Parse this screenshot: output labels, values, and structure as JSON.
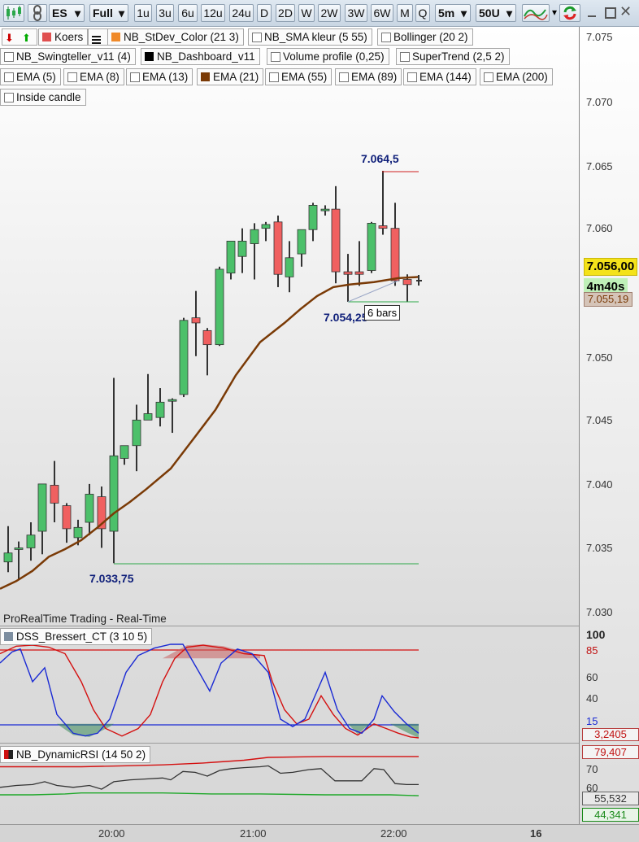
{
  "toolbar": {
    "symbol": "ES",
    "mode": "Full",
    "timeframes": [
      "1u",
      "3u",
      "6u",
      "12u",
      "24u",
      "D",
      "2D",
      "W",
      "2W",
      "3W",
      "6W",
      "M",
      "Q"
    ],
    "interval": "5m",
    "units": "50U"
  },
  "indicators": {
    "row1": [
      "Koers",
      "NB_StDev_Color (21 3)",
      "NB_SMA kleur (5 55)",
      "Bollinger (20 2)"
    ],
    "row2": [
      "NB_Swingteller_v11 (4)",
      "NB_Dashboard_v11",
      "Volume profile (0,25)",
      "SuperTrend (2,5 2)"
    ],
    "row3": [
      "EMA (5)",
      "EMA (8)",
      "EMA (13)",
      "EMA (21)",
      "EMA (55)",
      "EMA (89)",
      "EMA (144)",
      "EMA (200)"
    ],
    "row4": [
      "Inside candle"
    ],
    "dss": "DSS_Bressert_CT (3 10 5)",
    "rsi": "NB_DynamicRSI (14 50 2)",
    "colors": {
      "ema21": "#7a3a06",
      "dss_swatch": "#7d8ea0",
      "rsi_red": "#d01010"
    }
  },
  "chart": {
    "high_label": "7.064,5",
    "low_label": "7.033,75",
    "swing_low_label": "7.054,25",
    "bars_label": "6 bars",
    "footer": "ProRealTime Trading - Real-Time"
  },
  "price_axis": {
    "ticks": [
      "7.075",
      "7.070",
      "7.065",
      "7.060",
      "7.055",
      "7.050",
      "7.045",
      "7.040",
      "7.035",
      "7.030"
    ],
    "current_price": "7.056,00",
    "countdown": "4m40s",
    "ema_value": "7.055,19"
  },
  "dss_axis": {
    "ticks": [
      "100",
      "85",
      "60",
      "40",
      "15"
    ],
    "value": "3,2405"
  },
  "rsi_axis": {
    "ticks": [
      "79,407",
      "70",
      "60"
    ],
    "value": "55,532",
    "low": "44,341"
  },
  "time_axis": [
    "20:00",
    "21:00",
    "22:00",
    "16"
  ]
}
